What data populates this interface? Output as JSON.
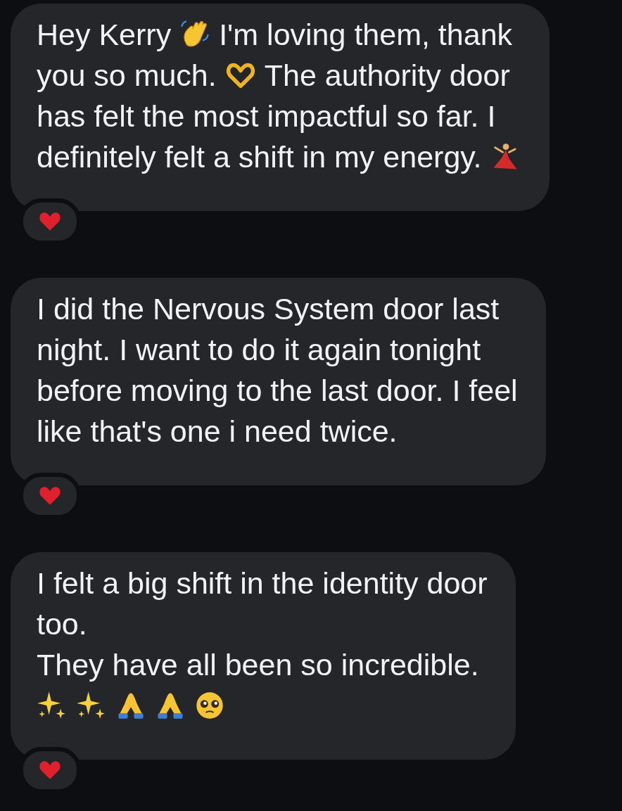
{
  "messages": [
    {
      "lines": [
        [
          {
            "kind": "text",
            "text": "Hey Kerry"
          },
          {
            "kind": "wave"
          },
          {
            "kind": "text",
            "text": "I'm loving them, thank"
          }
        ],
        [
          {
            "kind": "text",
            "text": "you so much."
          },
          {
            "kind": "heart-hands"
          },
          {
            "kind": "text",
            "text": "The authority door"
          }
        ],
        [
          {
            "kind": "text",
            "text": "has felt the most impactful so far. I"
          }
        ],
        [
          {
            "kind": "text",
            "text": "definitely felt a shift in my energy."
          },
          {
            "kind": "dancer"
          }
        ]
      ],
      "reactions": [
        {
          "kind": "heart"
        }
      ]
    },
    {
      "lines": [
        [
          {
            "kind": "text",
            "text": "I did the Nervous System door last"
          }
        ],
        [
          {
            "kind": "text",
            "text": "night. I want to do it again tonight"
          }
        ],
        [
          {
            "kind": "text",
            "text": "before moving to the last door. I feel"
          }
        ],
        [
          {
            "kind": "text",
            "text": "like that's one i need twice."
          }
        ]
      ],
      "reactions": [
        {
          "kind": "heart"
        }
      ]
    },
    {
      "lines": [
        [
          {
            "kind": "text",
            "text": "I felt a big shift in the identity door"
          }
        ],
        [
          {
            "kind": "text",
            "text": "too."
          }
        ],
        [
          {
            "kind": "text",
            "text": "They have all been so incredible."
          }
        ],
        [
          {
            "kind": "sparkles"
          },
          {
            "kind": "sparkles"
          },
          {
            "kind": "pray"
          },
          {
            "kind": "pray"
          },
          {
            "kind": "teary"
          }
        ]
      ],
      "reactions": [
        {
          "kind": "heart"
        }
      ]
    }
  ]
}
